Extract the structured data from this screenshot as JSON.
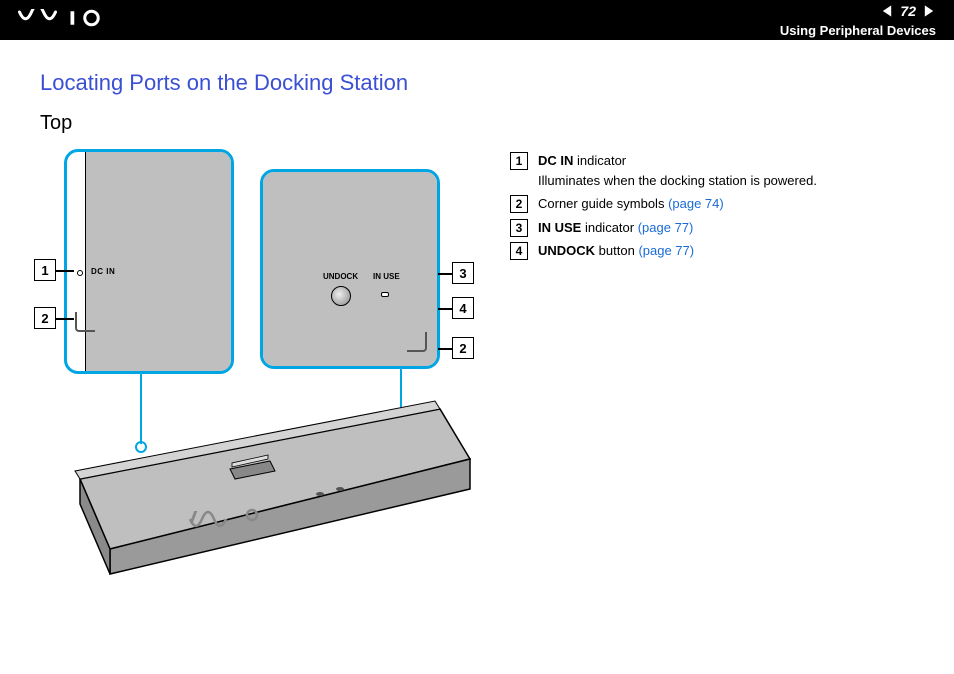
{
  "header": {
    "page_number": "72",
    "section": "Using Peripheral Devices"
  },
  "title": "Locating Ports on the Docking Station",
  "subtitle": "Top",
  "figure": {
    "dcin_label": "DC IN",
    "undock_label": "UNDOCK",
    "inuse_label": "IN USE",
    "callout_numbers": {
      "n1": "1",
      "n2": "2",
      "n3": "3",
      "n4": "4"
    }
  },
  "legend": [
    {
      "num": "1",
      "bold": "DC IN",
      "rest": " indicator",
      "sub": "Illuminates when the docking station is powered.",
      "link": null
    },
    {
      "num": "2",
      "bold": null,
      "rest": "Corner guide symbols ",
      "sub": null,
      "link": "(page 74)"
    },
    {
      "num": "3",
      "bold": "IN USE",
      "rest": " indicator ",
      "sub": null,
      "link": "(page 77)"
    },
    {
      "num": "4",
      "bold": "UNDOCK",
      "rest": " button ",
      "sub": null,
      "link": "(page 77)"
    }
  ]
}
